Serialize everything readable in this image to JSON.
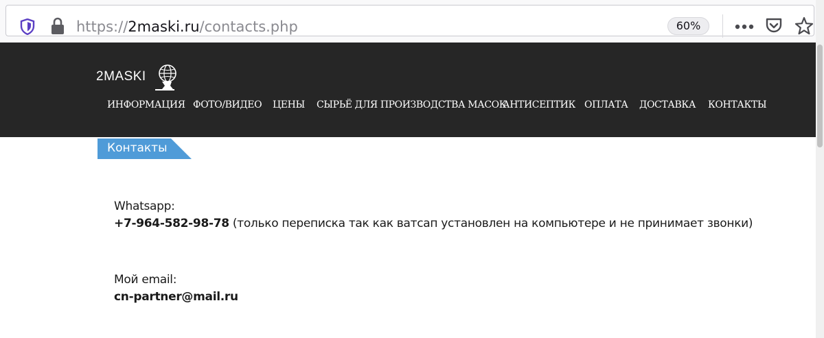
{
  "browser": {
    "url_scheme": "https://",
    "url_host": "2maski.ru",
    "url_path": "/contacts.php",
    "zoom": "60%"
  },
  "site": {
    "logo_text": "2MASKI",
    "nav": [
      {
        "label": "ИНФОРМАЦИЯ"
      },
      {
        "label": "ФОТО/ВИДЕО"
      },
      {
        "label": "ЦЕНЫ"
      },
      {
        "label": "СЫРЬЁ ДЛЯ ПРОИЗВОДСТВА МАСОК"
      },
      {
        "label": "АНТИСЕПТИК"
      },
      {
        "label": "ОПЛАТА"
      },
      {
        "label": "ДОСТАВКА"
      },
      {
        "label": "КОНТАКТЫ"
      }
    ]
  },
  "content": {
    "section_tag": "Контакты",
    "whatsapp_label": "Whatsapp:",
    "phone": "+7-964-582-98-78",
    "phone_note": " (только переписка так как ватсап установлен на компьютере и не принимает звонки)",
    "email_label": "Мой email:",
    "email": "cn-partner@mail.ru"
  },
  "colors": {
    "header_bg": "#262626",
    "tag_bg": "#4f9bd8",
    "private_shield": "#5b3fc4"
  }
}
